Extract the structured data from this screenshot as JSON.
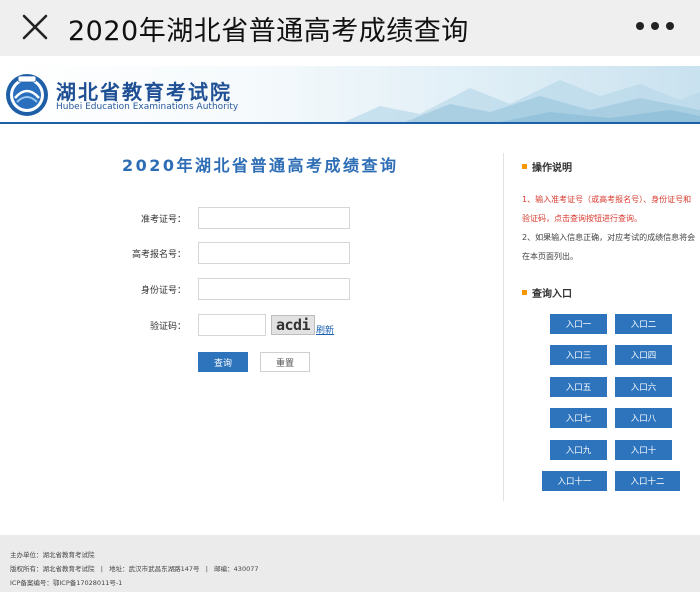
{
  "appbar": {
    "title": "2020年湖北省普通高考成绩查询"
  },
  "banner": {
    "org_name_cn": "湖北省教育考试院",
    "org_name_en": "Hubei Education Examinations Authority"
  },
  "query": {
    "title": "2020年湖北省普通高考成绩查询",
    "fields": [
      {
        "label": "准考证号：",
        "value": "",
        "placeholder": ""
      },
      {
        "label": "高考报名号：",
        "value": "",
        "placeholder": ""
      },
      {
        "label": "身份证号：",
        "value": "",
        "placeholder": ""
      }
    ],
    "captcha": {
      "label": "验证码：",
      "value": "",
      "image_text": "acdi",
      "refresh_label": "刷新"
    },
    "submit_label": "查询",
    "reset_label": "重置"
  },
  "instructions": {
    "heading": "操作说明",
    "lines": [
      "1、输入准考证号（或高考报名号）、身份证号和",
      "验证码，点击查询按钮进行查询。",
      "2、如果输入信息正确，对应考试的成绩信息将会",
      "在本页面列出。"
    ]
  },
  "entries": {
    "heading": "查询入口",
    "buttons": [
      "入口一",
      "入口二",
      "入口三",
      "入口四",
      "入口五",
      "入口六",
      "入口七",
      "入口八",
      "入口九",
      "入口十",
      "入口十一",
      "入口十二"
    ]
  },
  "footer": {
    "sponsor": "主办单位：湖北省教育考试院",
    "copyright": "版权所有：湖北省教育考试院",
    "address": "地址：武汉市武昌东湖路147号",
    "postcode": "邮编：430077",
    "icp": "ICP备案编号：鄂ICP备17028011号-1"
  },
  "colors": {
    "primary_blue": "#2d74bd",
    "accent_orange": "#f39800",
    "instruction_red": "#d83a2f"
  }
}
